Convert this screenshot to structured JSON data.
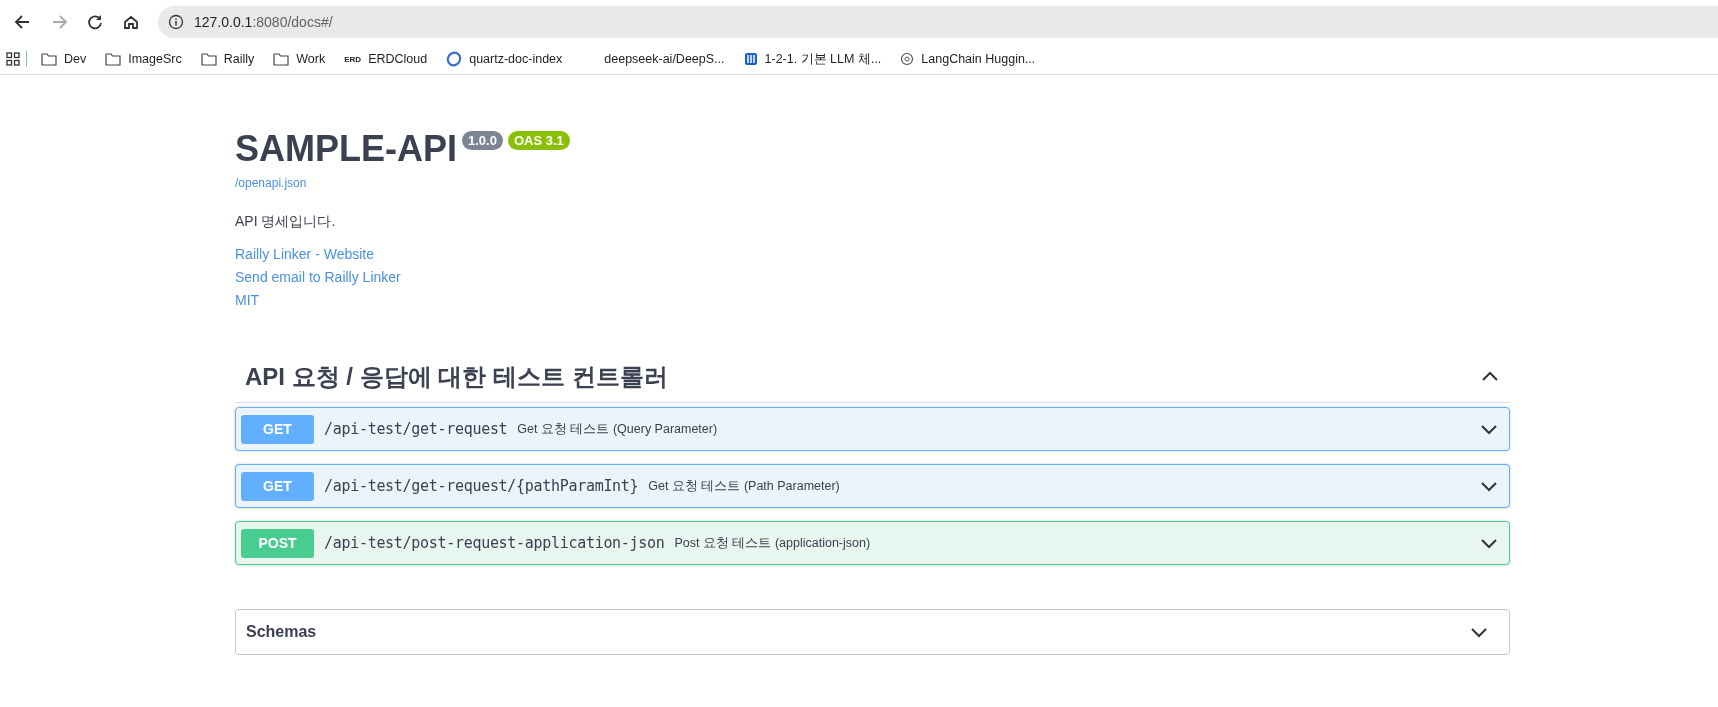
{
  "browser": {
    "url_host": "127.0.0.1",
    "url_rest": ":8080/docs#/",
    "bookmarks": [
      {
        "kind": "folder",
        "label": "Dev"
      },
      {
        "kind": "folder",
        "label": "ImageSrc"
      },
      {
        "kind": "folder",
        "label": "Railly"
      },
      {
        "kind": "folder",
        "label": "Work"
      },
      {
        "kind": "textlogo",
        "logo": "ERD",
        "label": "ERDCloud"
      },
      {
        "kind": "ring",
        "label": "quartz-doc-index"
      },
      {
        "kind": "blank",
        "label": "deepseek-ai/DeepS..."
      },
      {
        "kind": "book",
        "label": "1-2-1. 기본 LLM 체..."
      },
      {
        "kind": "flower",
        "label": "LangChain Huggin..."
      }
    ]
  },
  "info": {
    "title": "SAMPLE-API",
    "version": "1.0.0",
    "oas": "OAS 3.1",
    "spec_link": "/openapi.json",
    "description": "API 명세입니다.",
    "links": [
      "Railly Linker - Website",
      "Send email to Railly Linker"
    ],
    "license": "MIT"
  },
  "section": {
    "title": "API 요청 / 응답에 대한 테스트 컨트롤러",
    "expanded": true,
    "operations": [
      {
        "method": "GET",
        "path": "/api-test/get-request",
        "summary": "Get 요청 테스트 (Query Parameter)",
        "expanded": false
      },
      {
        "method": "GET",
        "path": "/api-test/get-request/{pathParamInt}",
        "summary": "Get 요청 테스트 (Path Parameter)",
        "expanded": false
      },
      {
        "method": "POST",
        "path": "/api-test/post-request-application-json",
        "summary": "Post 요청 테스트 (application-json)",
        "expanded": false
      }
    ]
  },
  "schemas": {
    "title": "Schemas",
    "expanded": false
  }
}
